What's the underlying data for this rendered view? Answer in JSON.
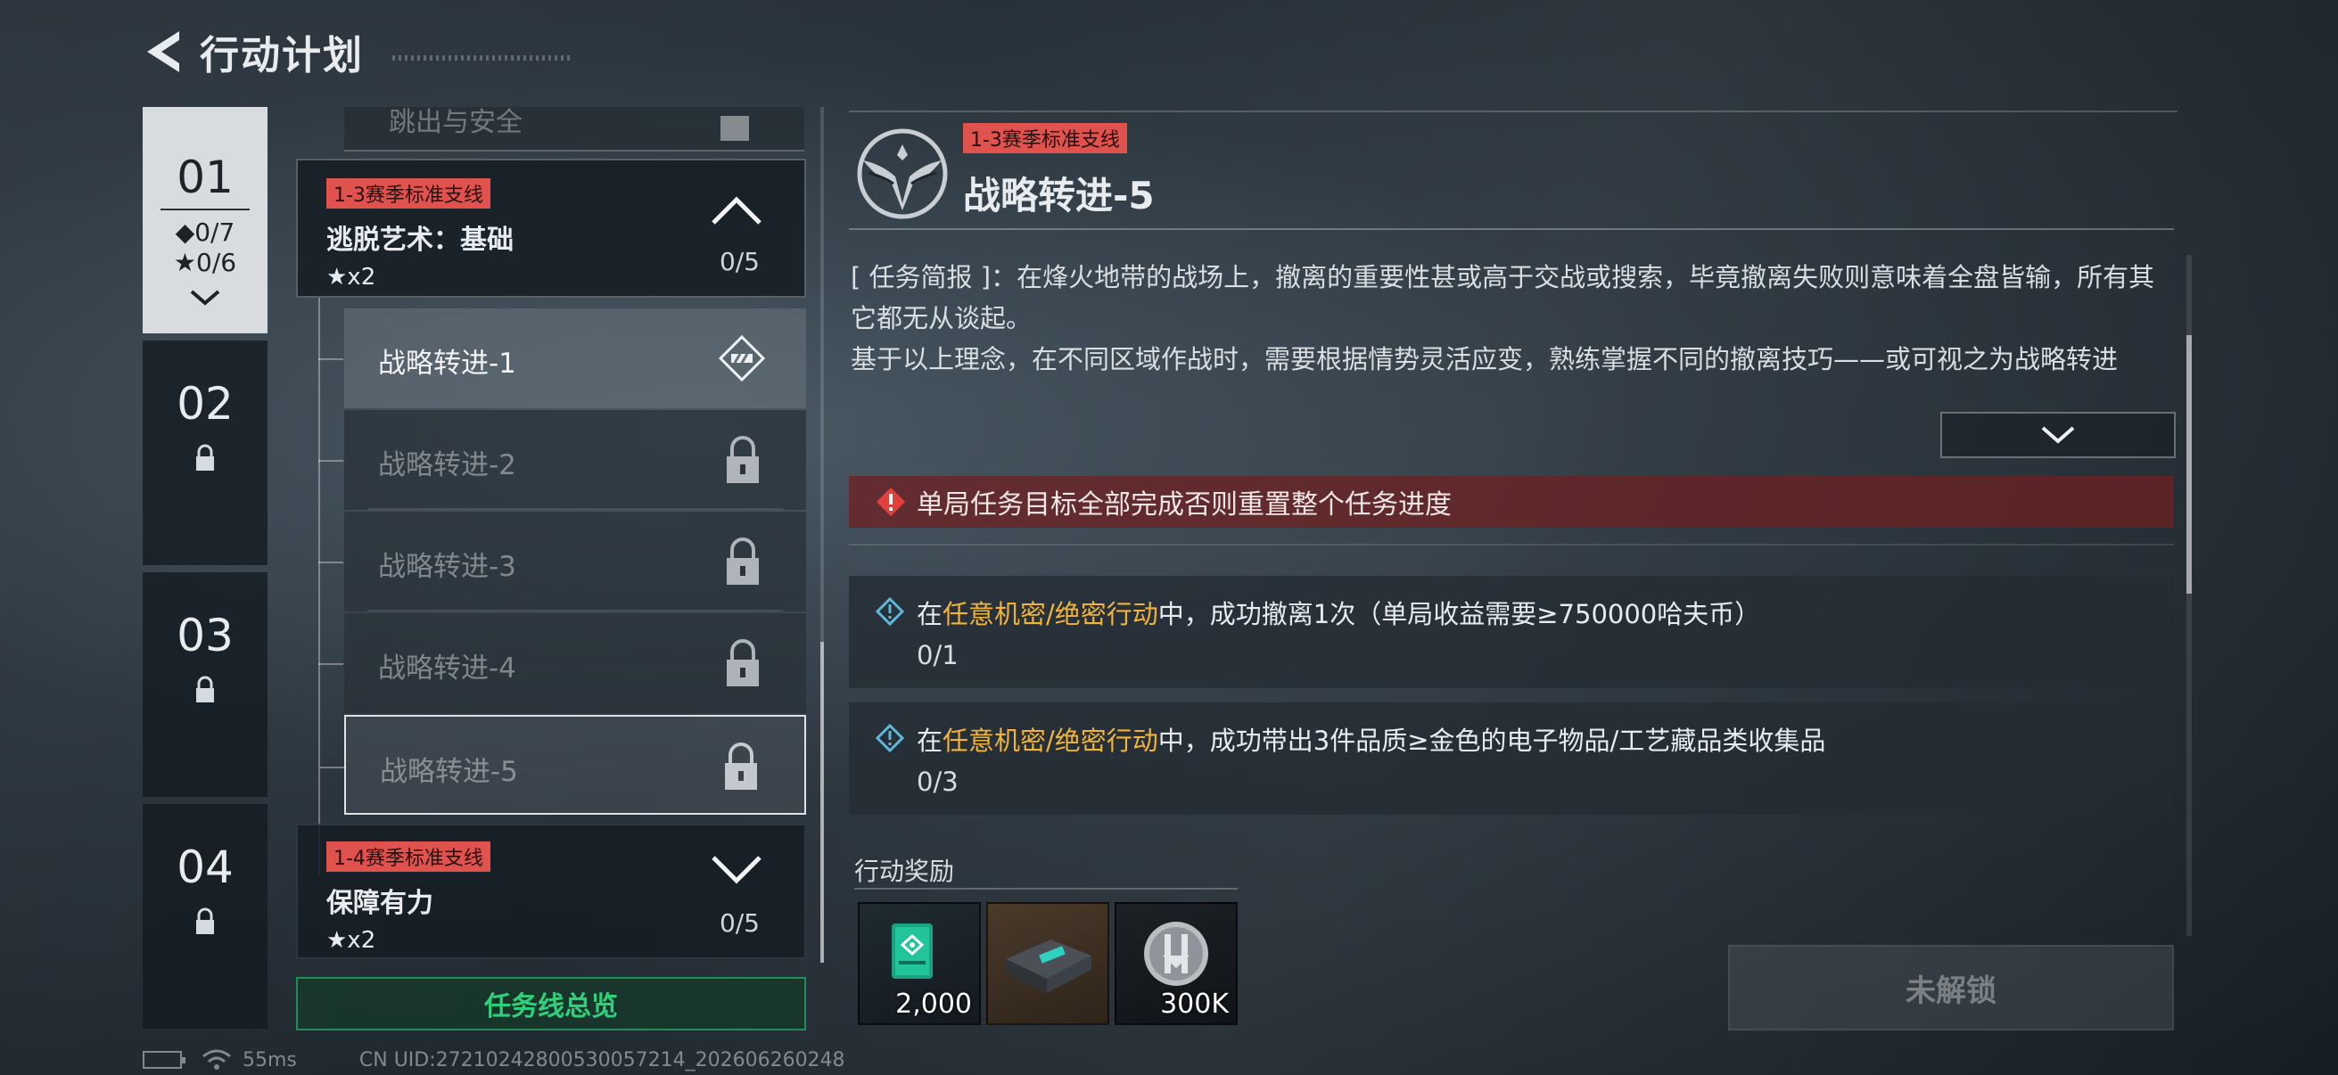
{
  "header": {
    "title": "行动计划"
  },
  "chapters": [
    {
      "num": "01",
      "diamond": "◆0/7",
      "star": "★0/6"
    },
    {
      "num": "02"
    },
    {
      "num": "03"
    },
    {
      "num": "04"
    }
  ],
  "quest_list": {
    "cut_item": "跳出与安全",
    "group1": {
      "tag": "1-3赛季标准支线",
      "name": "逃脱艺术：基础",
      "reward": "★x2",
      "count": "0/5"
    },
    "subtasks": [
      {
        "label": "战略转进-1"
      },
      {
        "label": "战略转进-2"
      },
      {
        "label": "战略转进-3"
      },
      {
        "label": "战略转进-4"
      },
      {
        "label": "战略转进-5"
      }
    ],
    "group2": {
      "tag": "1-4赛季标准支线",
      "name": "保障有力",
      "reward": "★x2",
      "count": "0/5"
    },
    "overview_button": "任务线总览"
  },
  "detail": {
    "tag": "1-3赛季标准支线",
    "title": "战略转进-5",
    "brief": "[ 任务简报 ]：在烽火地带的战场上，撤离的重要性甚或高于交战或搜索，毕竟撤离失败则意味着全盘皆输，所有其它都无从谈起。\n基于以上理念，在不同区域作战时，需要根据情势灵活应变，熟练掌握不同的撤离技巧——或可视之为战略转进",
    "warning": "单局任务目标全部完成否则重置整个任务进度",
    "objectives": [
      {
        "prefix": "在",
        "highlight": "任意机密/绝密行动",
        "suffix": "中，成功撤离1次（单局收益需要≥750000哈夫币）",
        "progress": "0/1"
      },
      {
        "prefix": "在",
        "highlight": "任意机密/绝密行动",
        "suffix": "中，成功带出3件品质≥金色的电子物品/工艺藏品类收集品",
        "progress": "0/3"
      }
    ],
    "reward_title": "行动奖励",
    "rewards": [
      {
        "icon": "green-card-icon",
        "amount": "2,000"
      },
      {
        "icon": "equipment-case-icon",
        "amount": ""
      },
      {
        "icon": "silver-coin-icon",
        "amount": "300K"
      }
    ],
    "status_button": "未解锁"
  },
  "status_bar": {
    "ping": "55ms",
    "uid": "CN UID:27210242800530057214_202606260248"
  },
  "colors": {
    "tag_red": "#e0524e",
    "highlight_gold": "#f0b43a",
    "overview_green": "#2fd07a",
    "warning_bg": "#6e2022"
  }
}
